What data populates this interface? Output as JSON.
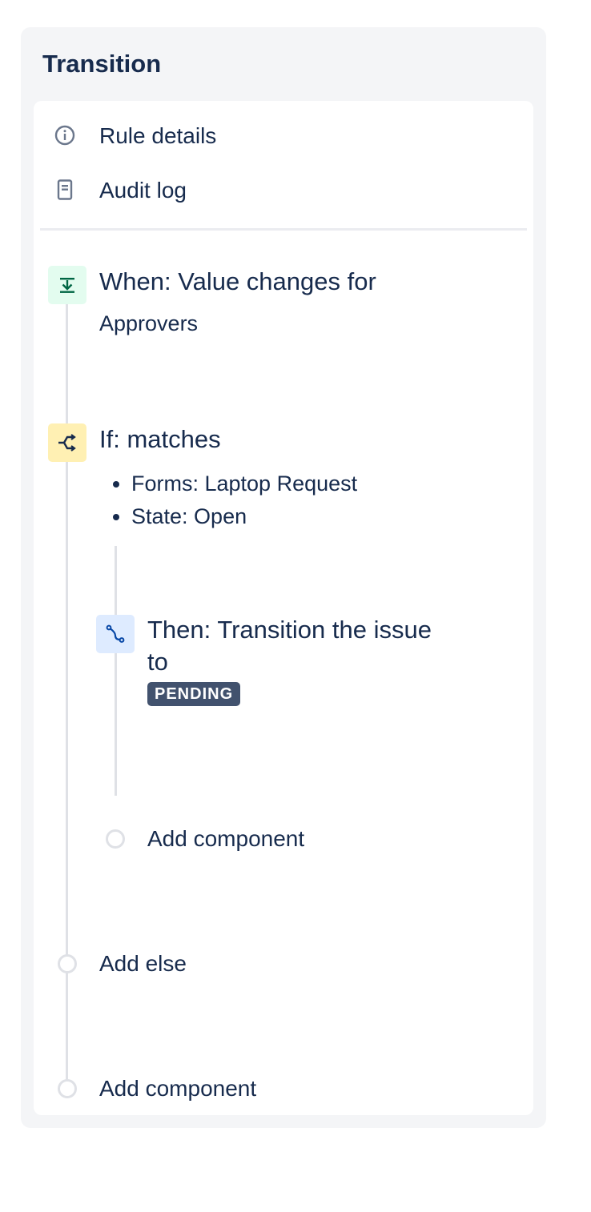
{
  "panel": {
    "title": "Transition"
  },
  "nav": {
    "rule_details": {
      "label": "Rule details",
      "icon": "info-icon"
    },
    "audit_log": {
      "label": "Audit log",
      "icon": "document-icon"
    }
  },
  "trigger": {
    "title": "When: Value changes for",
    "subtitle": "Approvers",
    "icon": "trigger-icon",
    "icon_bg": "#e3fcef",
    "icon_color": "#006644"
  },
  "condition": {
    "title": "If: matches",
    "items": [
      {
        "text": "Forms: Laptop Request"
      },
      {
        "text": "State: Open"
      }
    ],
    "icon": "branch-icon",
    "icon_bg": "#fff0b3",
    "icon_color": "#172b4d"
  },
  "action": {
    "title_line1": "Then: Transition the issue",
    "title_line2": "to",
    "status": "PENDING",
    "icon": "transition-icon",
    "icon_bg": "#deebff",
    "icon_color": "#0747a6"
  },
  "add_component_inner": {
    "label": "Add component"
  },
  "add_else": {
    "label": "Add else"
  },
  "add_component_outer": {
    "label": "Add component"
  }
}
